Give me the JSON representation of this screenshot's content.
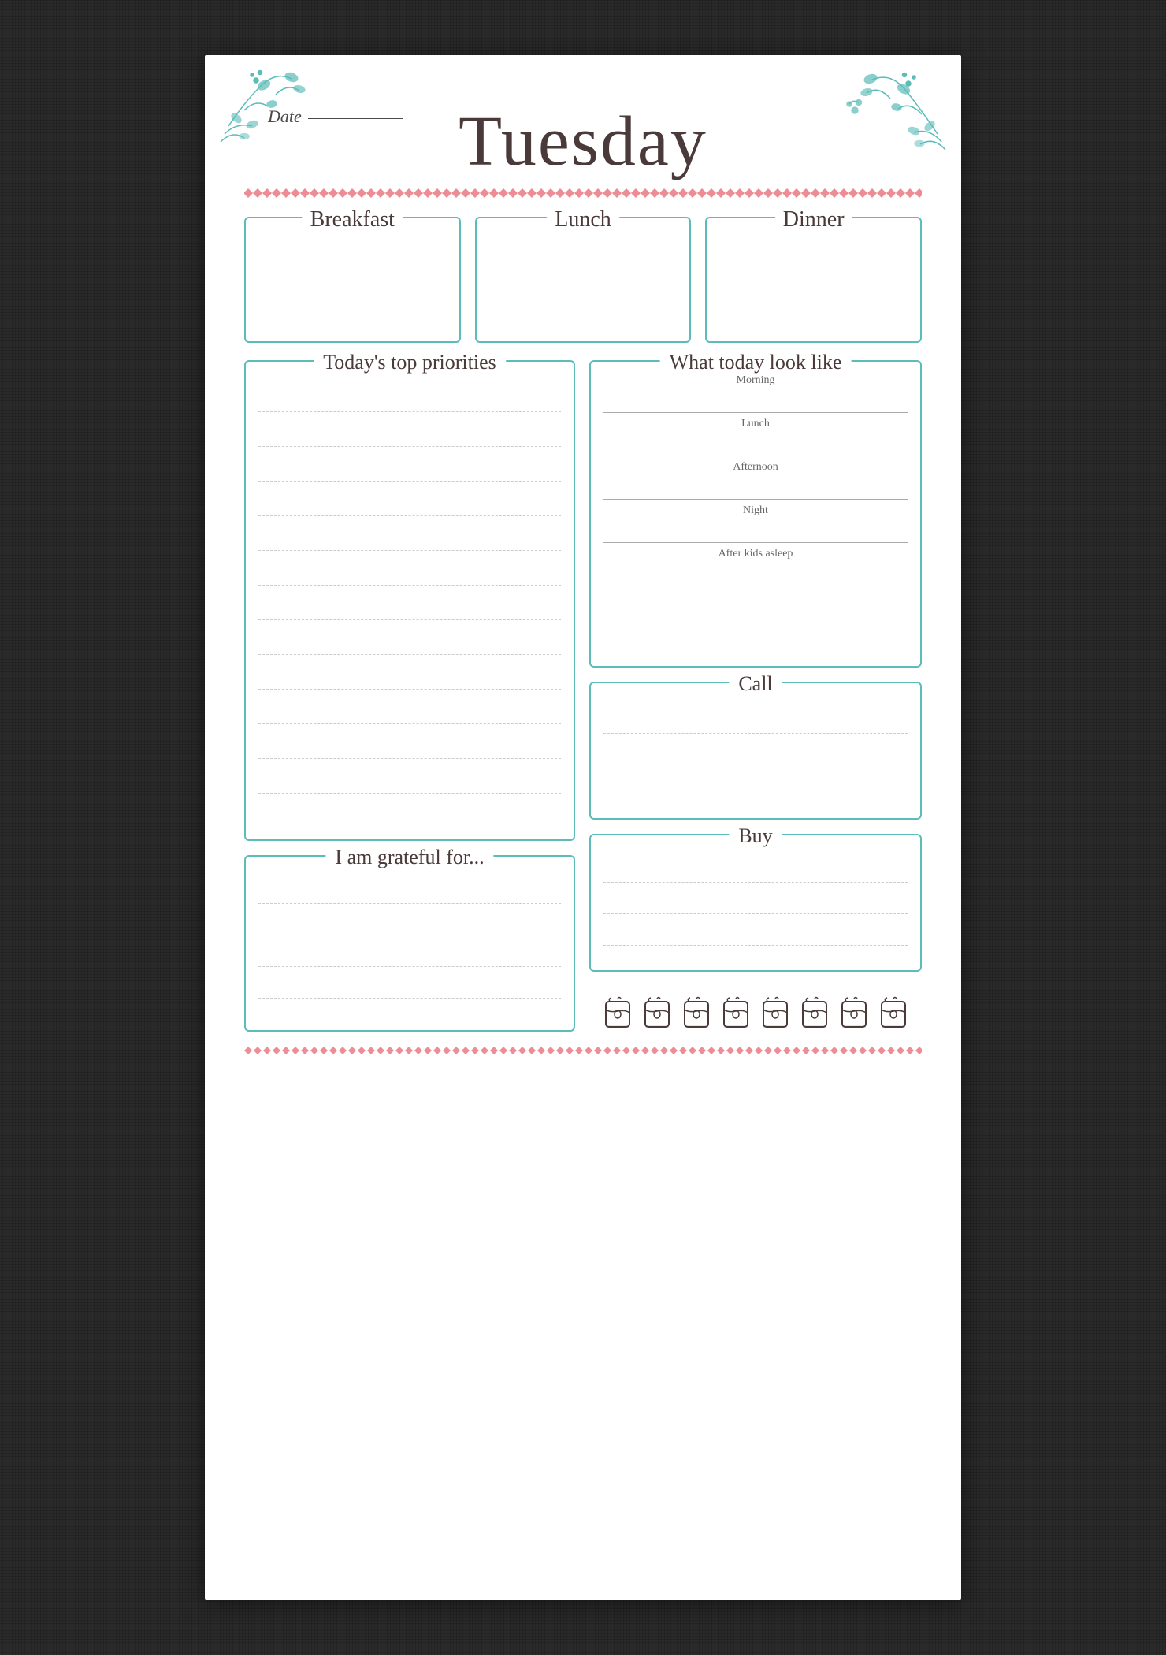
{
  "header": {
    "title": "Tuesday",
    "date_label": "Date"
  },
  "meals": [
    {
      "id": "breakfast",
      "label": "Breakfast"
    },
    {
      "id": "lunch",
      "label": "Lunch"
    },
    {
      "id": "dinner",
      "label": "Dinner"
    }
  ],
  "sections": {
    "priorities": {
      "label": "Today's top priorities",
      "line_count": 12
    },
    "what_today": {
      "label": "What today look like",
      "time_slots": [
        "Morning",
        "Lunch",
        "Afternoon",
        "Night",
        "After kids asleep"
      ]
    },
    "call": {
      "label": "Call",
      "line_count": 2
    },
    "grateful": {
      "label": "I am grateful for...",
      "line_count": 4
    },
    "buy": {
      "label": "Buy",
      "line_count": 3
    }
  },
  "water": {
    "cups": 8
  },
  "colors": {
    "teal": "#5bbcb8",
    "pink": "#e8707a",
    "title": "#4a3a3a",
    "text": "#666666",
    "dashed_line": "#cccccc"
  }
}
